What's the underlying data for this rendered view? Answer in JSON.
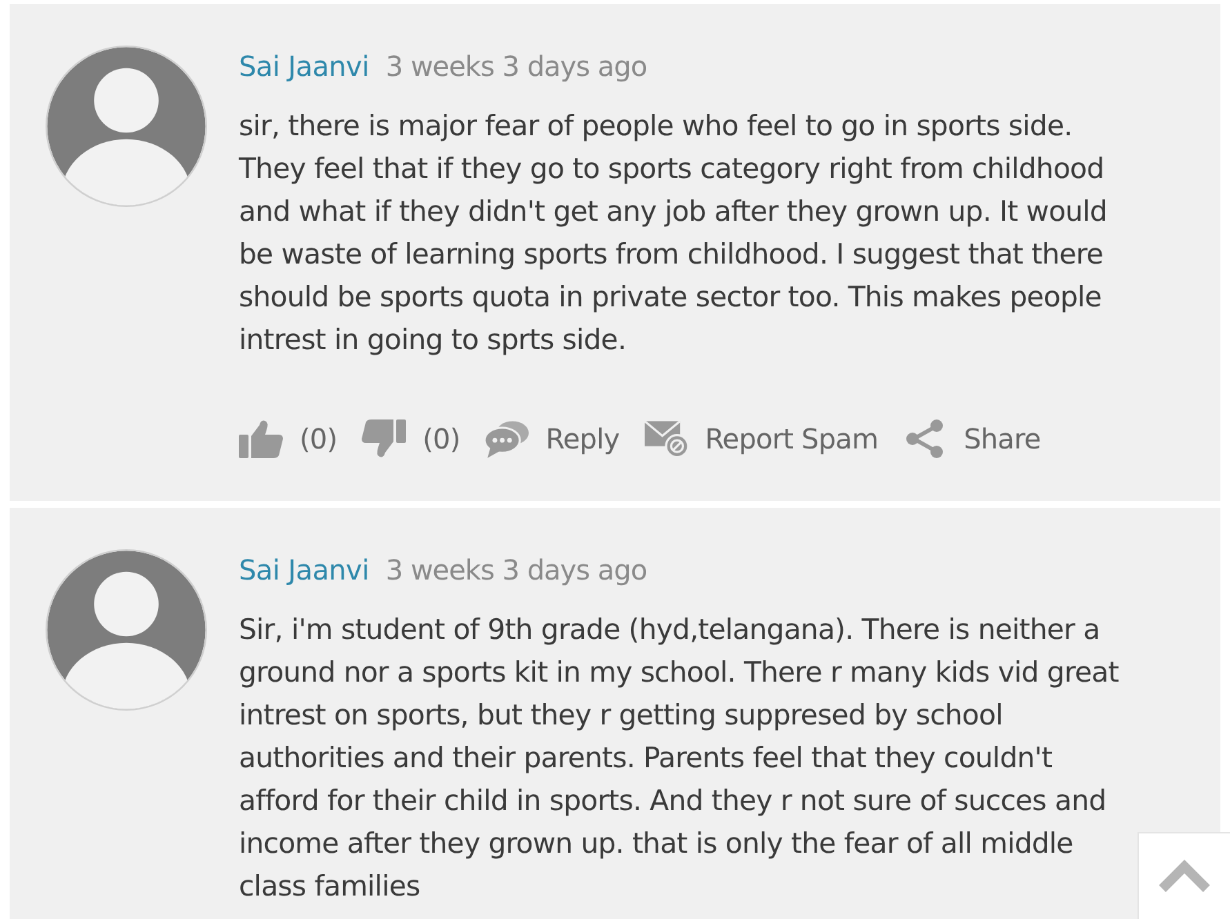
{
  "comments": [
    {
      "author": "Sai Jaanvi",
      "time": "3 weeks 3 days ago",
      "text": "sir, there is major fear of people who feel to go in sports side. They feel that if they go to sports category right from childhood and what if they didn't get any job after they grown up. It would be waste of learning sports from childhood. I suggest that there should be sports quota in private sector too. This makes people intrest in going to sprts side.",
      "actions": [
        {
          "kind": "like",
          "label": "(0)"
        },
        {
          "kind": "dislike",
          "label": "(0)"
        },
        {
          "kind": "reply",
          "label": "Reply"
        },
        {
          "kind": "spam",
          "label": "Report Spam"
        },
        {
          "kind": "share",
          "label": "Share"
        }
      ]
    },
    {
      "author": "Sai Jaanvi",
      "time": "3 weeks 3 days ago",
      "text": "Sir, i'm student of 9th grade (hyd,telangana). There is neither a ground nor a sports kit in my school. There r many kids vid great intrest on sports, but they r getting suppresed by school authorities and their parents. Parents feel that they couldn't afford for their child in sports. And they r not sure of succes and income after they grown up. that is only the fear of all middle class families"
    }
  ],
  "scroll_top_button": {
    "shown": true
  }
}
